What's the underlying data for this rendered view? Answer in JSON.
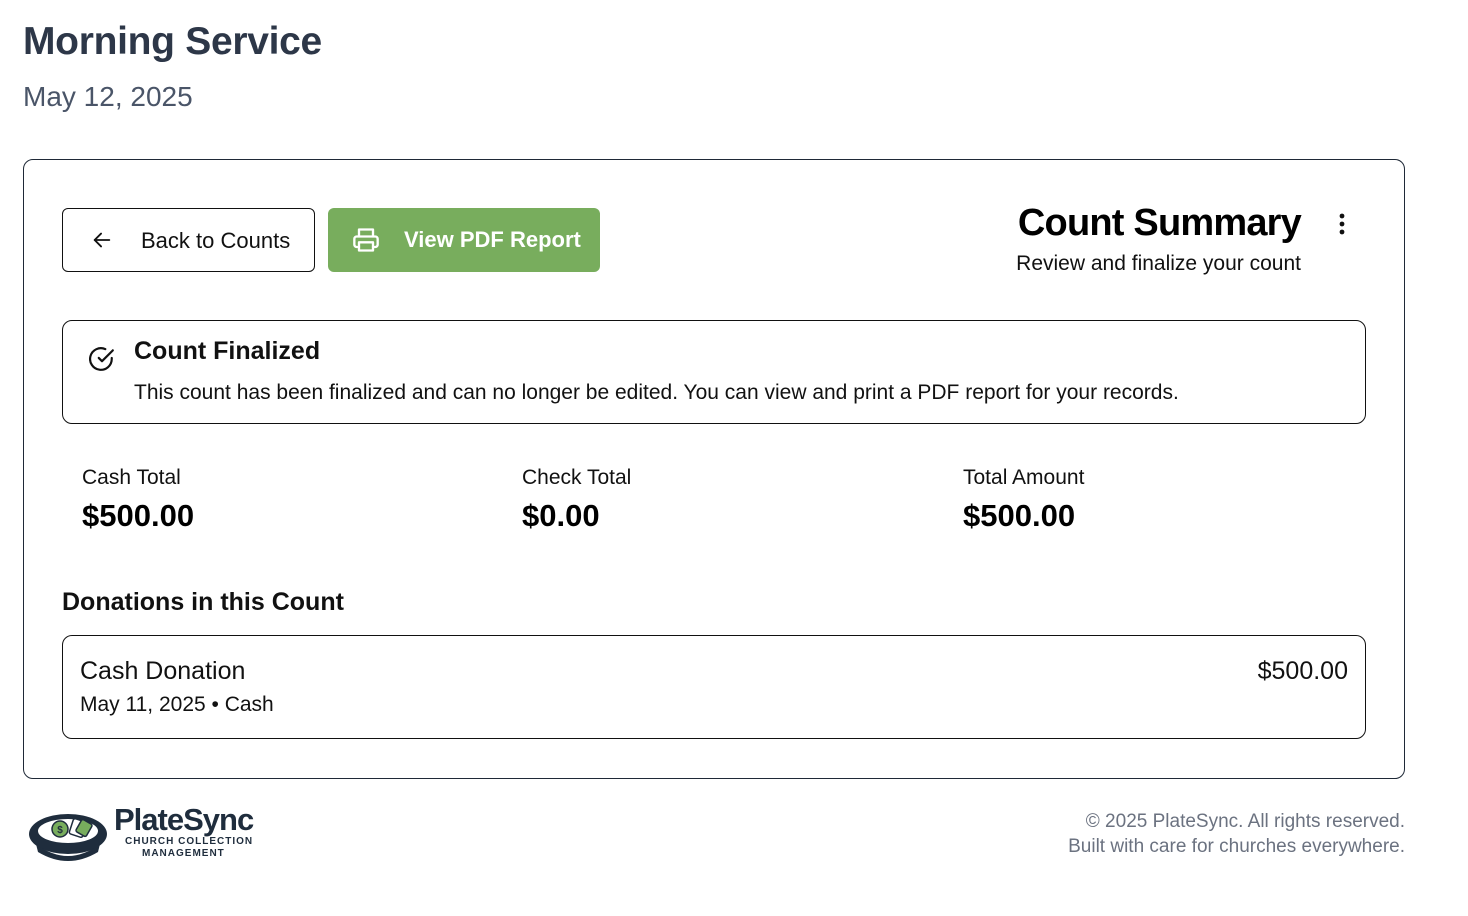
{
  "header": {
    "title": "Morning Service",
    "date": "May 12, 2025"
  },
  "toolbar": {
    "back_label": "Back to Counts",
    "pdf_label": "View PDF Report"
  },
  "summary": {
    "title": "Count Summary",
    "subtitle": "Review and finalize your count"
  },
  "alert": {
    "title": "Count Finalized",
    "message": "This count has been finalized and can no longer be edited. You can view and print a PDF report for your records."
  },
  "stats": [
    {
      "label": "Cash Total",
      "value": "$500.00"
    },
    {
      "label": "Check Total",
      "value": "$0.00"
    },
    {
      "label": "Total Amount",
      "value": "$500.00"
    }
  ],
  "donations": {
    "heading": "Donations in this Count",
    "items": [
      {
        "name": "Cash Donation",
        "meta": "May 11, 2025 • Cash",
        "amount": "$500.00"
      }
    ]
  },
  "footer": {
    "brand": "PlateSync",
    "tagline_line1": "CHURCH COLLECTION",
    "tagline_line2": "MANAGEMENT",
    "copyright": "© 2025 PlateSync. All rights reserved.",
    "note": "Built with care for churches everywhere."
  },
  "colors": {
    "accent": "#78ad5d",
    "title": "#2d3748",
    "muted": "#6b7280"
  },
  "icons": {
    "back": "arrow-left-icon",
    "pdf": "printer-icon",
    "menu": "more-vertical-icon",
    "alert": "check-circle-icon"
  }
}
